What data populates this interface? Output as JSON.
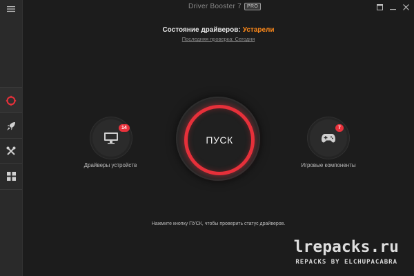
{
  "app": {
    "title": "Driver Booster 7",
    "edition_badge": "PRO"
  },
  "sidebar": {
    "items": [
      {
        "name": "menu",
        "icon": "hamburger-icon"
      },
      {
        "name": "scan",
        "icon": "scan-ring-icon",
        "active": true
      },
      {
        "name": "boost",
        "icon": "rocket-icon"
      },
      {
        "name": "tools",
        "icon": "tools-icon"
      },
      {
        "name": "action-center",
        "icon": "grid-icon"
      }
    ]
  },
  "status": {
    "label": "Состояние драйверов:",
    "value": "Устарели",
    "last_check": "Последняя проверка: Сегодня"
  },
  "left_item": {
    "label": "Драйверы устройств",
    "badge": "14",
    "icon": "monitor-icon"
  },
  "right_item": {
    "label": "Игровые компоненты",
    "badge": "7",
    "icon": "gamepad-icon"
  },
  "scan_button": {
    "label": "ПУСК"
  },
  "hint": "Нажмите кнопку ПУСК, чтобы проверить статус драйверов.",
  "watermark": {
    "site": "lrepacks.ru",
    "credit": "REPACKS BY ELCHUPACABRA"
  },
  "colors": {
    "accent_red": "#e6303a",
    "status_orange": "#ff8a1a",
    "background": "#1c1c1c",
    "sidebar": "#2a2a2a"
  }
}
